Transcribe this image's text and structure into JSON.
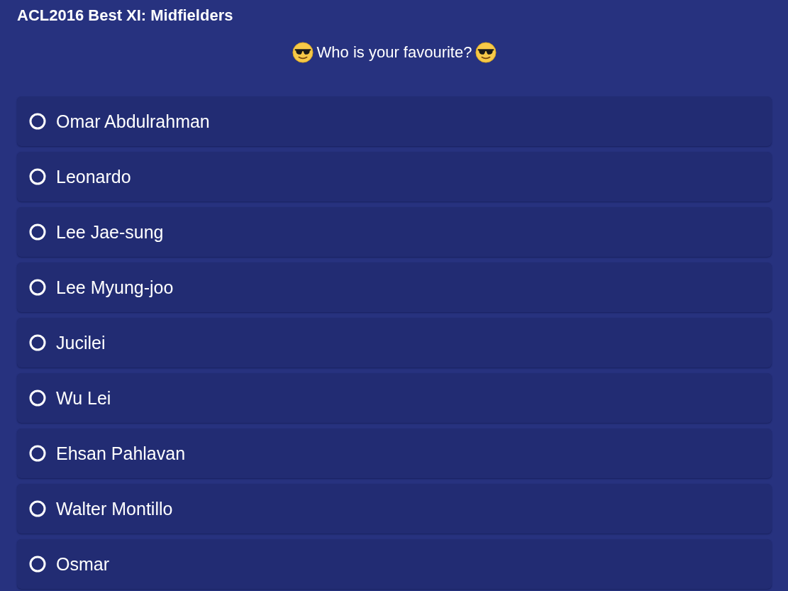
{
  "title": "ACL2016 Best XI: Midfielders",
  "question": "Who is your favourite?",
  "options": [
    {
      "label": "Omar Abdulrahman",
      "selected": false
    },
    {
      "label": "Leonardo",
      "selected": false
    },
    {
      "label": "Lee Jae-sung",
      "selected": false
    },
    {
      "label": "Lee Myung-joo",
      "selected": false
    },
    {
      "label": "Jucilei",
      "selected": false
    },
    {
      "label": "Wu Lei",
      "selected": false
    },
    {
      "label": "Ehsan Pahlavan",
      "selected": false
    },
    {
      "label": "Walter Montillo",
      "selected": false
    },
    {
      "label": "Osmar",
      "selected": false
    }
  ]
}
